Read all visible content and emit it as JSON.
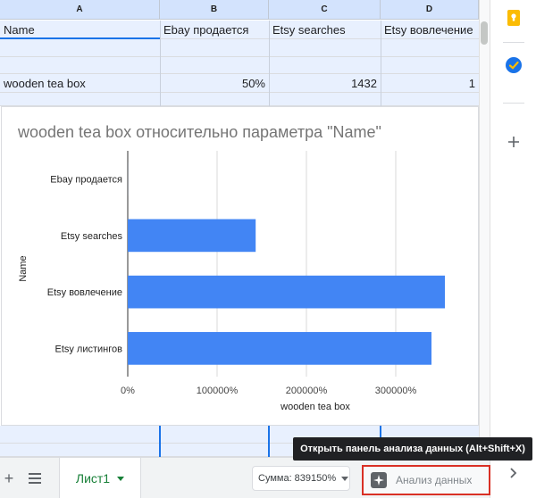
{
  "columns": [
    {
      "letter": "A"
    },
    {
      "letter": "B"
    },
    {
      "letter": "C"
    },
    {
      "letter": "D"
    }
  ],
  "rows": {
    "header": [
      "Name",
      "Ebay продается",
      "Etsy searches",
      "Etsy вовлечение"
    ],
    "data": [
      "wooden tea box",
      "50%",
      "1432",
      "1"
    ]
  },
  "chart_data": {
    "type": "bar",
    "orientation": "horizontal",
    "title": "wooden tea box относительно параметра \"Name\"",
    "xlabel": "wooden tea box",
    "ylabel": "Name",
    "categories": [
      "Ebay продается",
      "Etsy searches",
      "Etsy вовлечение",
      "Etsy листингов"
    ],
    "values": [
      50,
      143200,
      355000,
      340000
    ],
    "xlim": [
      0,
      375000
    ],
    "xticks": [
      0,
      100000,
      200000,
      300000
    ],
    "xtick_labels": [
      "0%",
      "100000%",
      "200000%",
      "300000%"
    ],
    "grid": true,
    "color": "#4285f4"
  },
  "sidepanel": {
    "icons": [
      "keep-icon",
      "tasks-icon",
      "add-icon"
    ]
  },
  "bottombar": {
    "add_sheet": "+",
    "sheet_tab_label": "Лист1",
    "sum_label": "Сумма: 839150%",
    "explore_label": "Анализ данных",
    "tooltip": "Открыть панель анализа данных (Alt+Shift+X)"
  },
  "colors": {
    "accent": "#1a73e8",
    "bar": "#4285f4",
    "sheet_tab": "#188038",
    "highlight": "#d93025"
  }
}
